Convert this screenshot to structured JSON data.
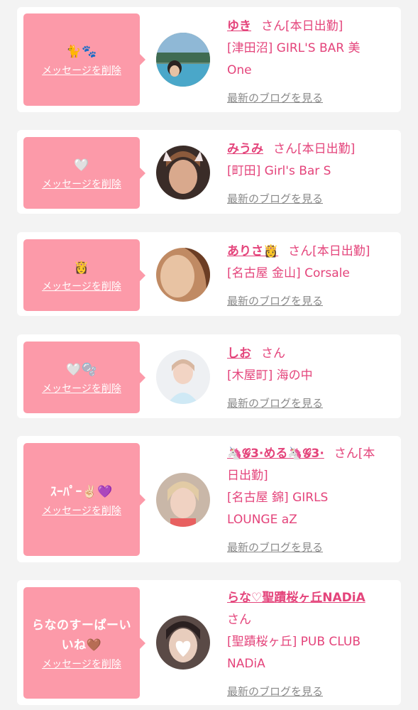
{
  "colors": {
    "background": "#f3f3f3",
    "card": "#ffffff",
    "message_box": "#fc9aa9",
    "accent_pink": "#e4447b",
    "link_gray": "#8a8a8a"
  },
  "entries": [
    {
      "message": "🐈🐾",
      "delete_label": "メッセージを削除",
      "name": "ゆき",
      "san": "さん",
      "status": "[本日出勤]",
      "shop_lines": [
        "[津田沼] GIRL'S BAR 美",
        "One"
      ],
      "blog_label": "最新のブログを見る",
      "avatar_icon": "avatar-photo"
    },
    {
      "message": "🤍",
      "delete_label": "メッセージを削除",
      "name": "みうみ",
      "san": "さん",
      "status": "[本日出勤]",
      "shop_lines": [
        "[町田] Girl's Bar S"
      ],
      "blog_label": "最新のブログを見る",
      "avatar_icon": "avatar-photo"
    },
    {
      "message": "👸",
      "delete_label": "メッセージを削除",
      "name": "ありさ👸",
      "san": "さん",
      "status": "[本日出勤]",
      "shop_lines": [
        "[名古屋 金山] Corsale"
      ],
      "blog_label": "最新のブログを見る",
      "avatar_icon": "avatar-photo"
    },
    {
      "message": "🤍🫧",
      "delete_label": "メッセージを削除",
      "name": "しお",
      "san": "さん",
      "status": "",
      "shop_lines": [
        "[木屋町] 海の中"
      ],
      "blog_label": "最新のブログを見る",
      "avatar_icon": "avatar-photo"
    },
    {
      "message": "ｽｰﾊﾟｰ✌🏻💜",
      "delete_label": "メッセージを削除",
      "name": "🦄𝓖3·める🦄𝓖3·",
      "san": "さん",
      "status_lines": [
        "[本",
        "日出勤]"
      ],
      "shop_lines": [
        "[名古屋 錦] GIRLS",
        "LOUNGE aZ"
      ],
      "blog_label": "最新のブログを見る",
      "avatar_icon": "avatar-photo"
    },
    {
      "message": "らなのすーぱーいいね🤎",
      "delete_label": "メッセージを削除",
      "name": "らな♡聖蹟桜ヶ丘NADiA",
      "san": "さん",
      "status": "",
      "shop_lines": [
        "[聖蹟桜ヶ丘] PUB CLUB",
        "NADiA"
      ],
      "blog_label": "最新のブログを見る",
      "avatar_icon": "avatar-photo"
    }
  ]
}
